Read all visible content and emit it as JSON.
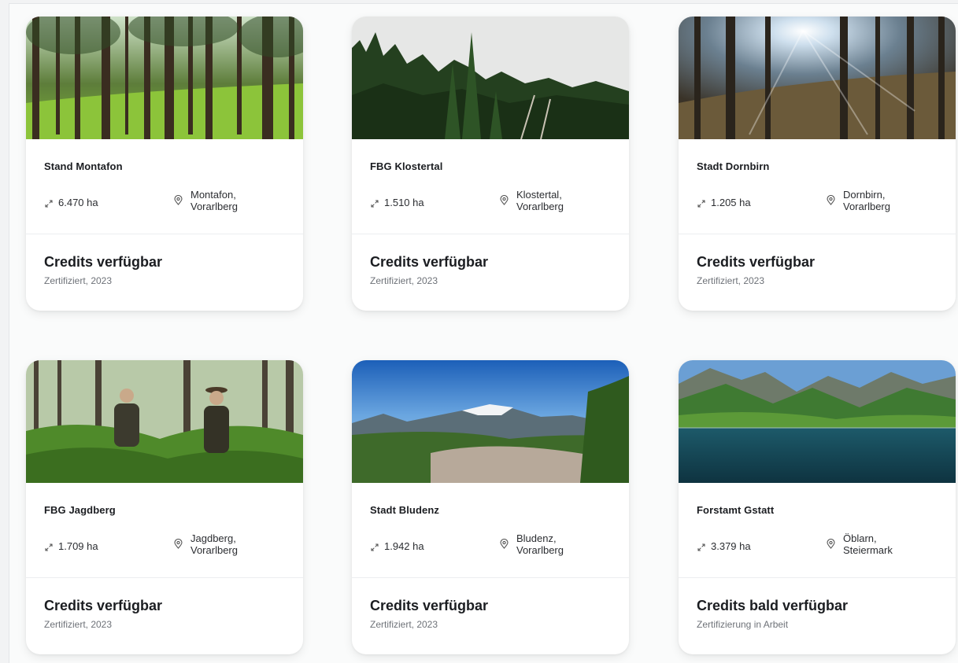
{
  "projects": [
    {
      "name": "Stand Montafon",
      "area": "6.470 ha",
      "location_line1": "Montafon,",
      "location_line2": "Vorarlberg",
      "credit_title": "Credits verfügbar",
      "credit_sub": "Zertifiziert, 2023",
      "image": "forest-tall-trees"
    },
    {
      "name": "FBG Klostertal",
      "area": "1.510 ha",
      "location_line1": "Klostertal,",
      "location_line2": "Vorarlberg",
      "credit_title": "Credits verfügbar",
      "credit_sub": "Zertifiziert, 2023",
      "image": "spruce-forest-sky"
    },
    {
      "name": "Stadt Dornbirn",
      "area": "1.205 ha",
      "location_line1": "Dornbirn,",
      "location_line2": "Vorarlberg",
      "credit_title": "Credits verfügbar",
      "credit_sub": "Zertifiziert, 2023",
      "image": "sunlit-forest"
    },
    {
      "name": "FBG Jagdberg",
      "area": "1.709 ha",
      "location_line1": "Jagdberg,",
      "location_line2": "Vorarlberg",
      "credit_title": "Credits verfügbar",
      "credit_sub": "Zertifiziert, 2023",
      "image": "foresters-in-forest"
    },
    {
      "name": "Stadt Bludenz",
      "area": "1.942 ha",
      "location_line1": "Bludenz,",
      "location_line2": "Vorarlberg",
      "credit_title": "Credits verfügbar",
      "credit_sub": "Zertifiziert, 2023",
      "image": "alpine-town-panorama"
    },
    {
      "name": "Forstamt Gstatt",
      "area": "3.379 ha",
      "location_line1": "Öblarn,",
      "location_line2": "Steiermark",
      "credit_title": "Credits bald verfügbar",
      "credit_sub": "Zertifizierung in Arbeit",
      "image": "mountain-lake"
    }
  ],
  "icons": {
    "area": "expand-arrows-icon",
    "location": "map-pin-icon"
  },
  "colors": {
    "text_primary": "#1b1d21",
    "text_secondary": "#6e7278",
    "card_bg": "#ffffff",
    "page_bg": "#fafbfb"
  }
}
